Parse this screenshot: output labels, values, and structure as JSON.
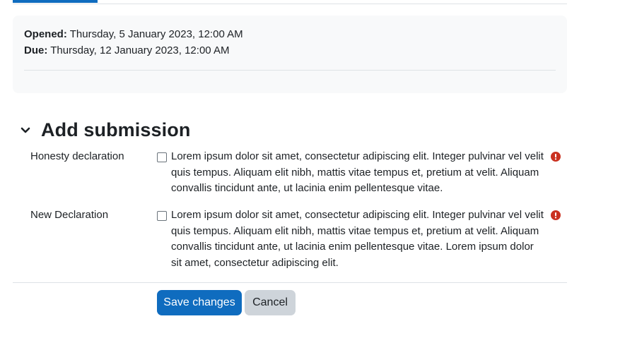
{
  "dates": {
    "opened_label": "Opened:",
    "opened_value": "Thursday, 5 January 2023, 12:00 AM",
    "due_label": "Due:",
    "due_value": "Thursday, 12 January 2023, 12:00 AM"
  },
  "section": {
    "title": "Add submission",
    "toggle_icon": "chevron-down-icon"
  },
  "form": {
    "fields": [
      {
        "label": "Honesty declaration",
        "checked": false,
        "text": "Lorem ipsum dolor sit amet, consectetur adipiscing elit. Integer pulvinar vel velit quis tempus. Aliquam elit nibh, mattis vitae tempus et, pretium at velit. Aliquam convallis tincidunt ante, ut lacinia enim pellentesque vitae.",
        "required_icon": "exclamation-circle-icon"
      },
      {
        "label": "New Declaration",
        "checked": false,
        "text": "Lorem ipsum dolor sit amet, consectetur adipiscing elit. Integer pulvinar vel velit quis tempus. Aliquam elit nibh, mattis vitae tempus et, pretium at velit. Aliquam convallis tincidunt ante, ut lacinia enim pellentesque vitae. Lorem ipsum dolor sit amet, consectetur adipiscing elit.",
        "required_icon": "exclamation-circle-icon"
      }
    ],
    "save_label": "Save changes",
    "cancel_label": "Cancel"
  },
  "colors": {
    "primary": "#0f6cbf",
    "required": "#ca3120",
    "panel_bg": "#f8f9fa",
    "secondary_button": "#ced4da"
  }
}
